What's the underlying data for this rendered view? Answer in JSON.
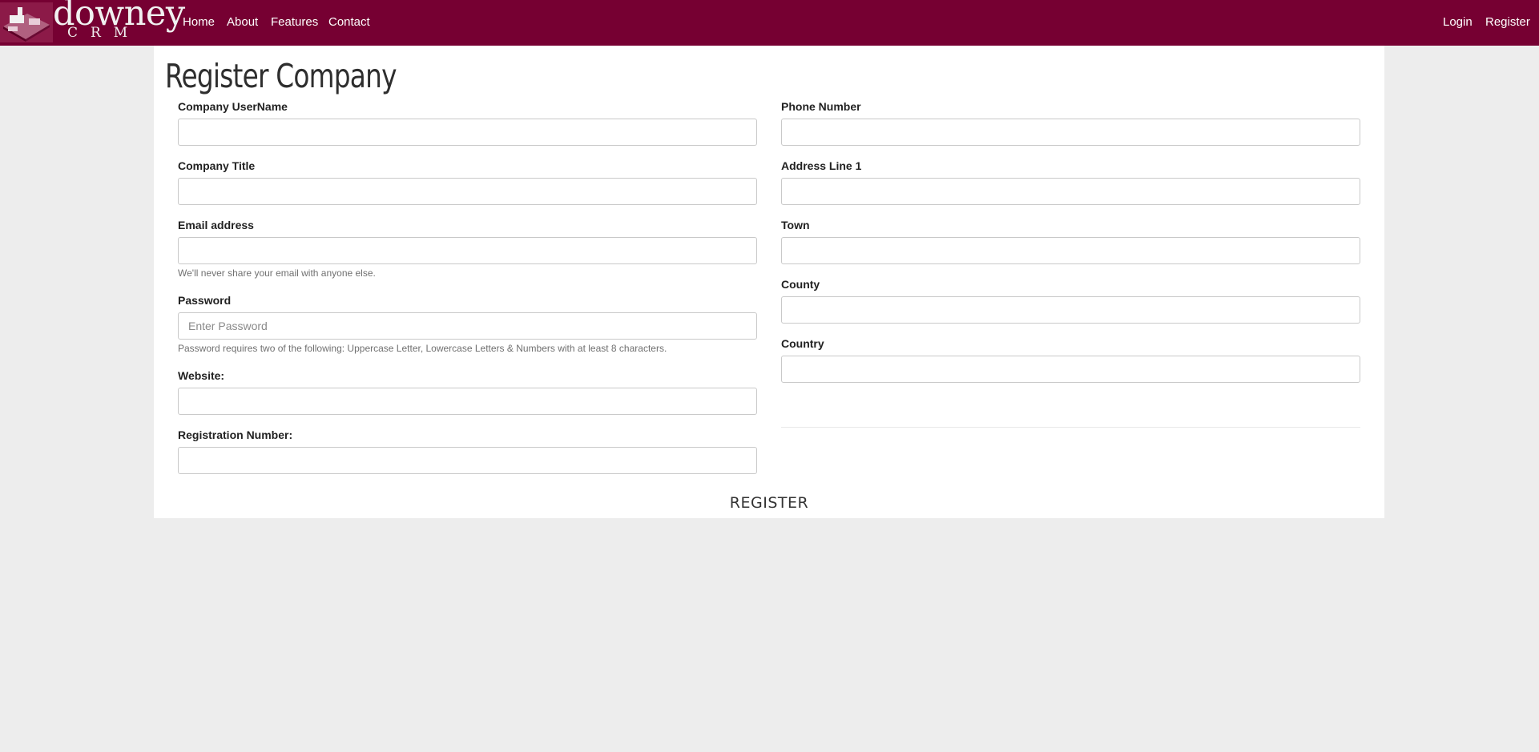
{
  "brand": {
    "name": "downey",
    "sub": "CRM"
  },
  "nav": {
    "home": "Home",
    "about": "About",
    "features": "Features",
    "contact": "Contact",
    "login": "Login",
    "register": "Register"
  },
  "page": {
    "title": "Register Company"
  },
  "form": {
    "company_username": {
      "label": "Company UserName",
      "value": ""
    },
    "company_title": {
      "label": "Company Title",
      "value": ""
    },
    "email": {
      "label": "Email address",
      "value": "",
      "help": "We'll never share your email with anyone else."
    },
    "password": {
      "label": "Password",
      "placeholder": "Enter Password",
      "help": "Password requires two of the following: Uppercase Letter, Lowercase Letters & Numbers with at least 8 characters."
    },
    "website": {
      "label": "Website:",
      "value": ""
    },
    "registration_number": {
      "label": "Registration Number:",
      "value": ""
    },
    "phone_number": {
      "label": "Phone Number",
      "value": ""
    },
    "address_line_1": {
      "label": "Address Line 1",
      "value": ""
    },
    "town": {
      "label": "Town",
      "value": ""
    },
    "county": {
      "label": "County",
      "value": ""
    },
    "country": {
      "label": "Country",
      "value": ""
    },
    "submit_label": "REGISTER"
  },
  "colors": {
    "navbar": "#760032",
    "background": "#ededed",
    "panel": "#ffffff"
  },
  "icons": {
    "logo": "crm-logo-icon"
  }
}
